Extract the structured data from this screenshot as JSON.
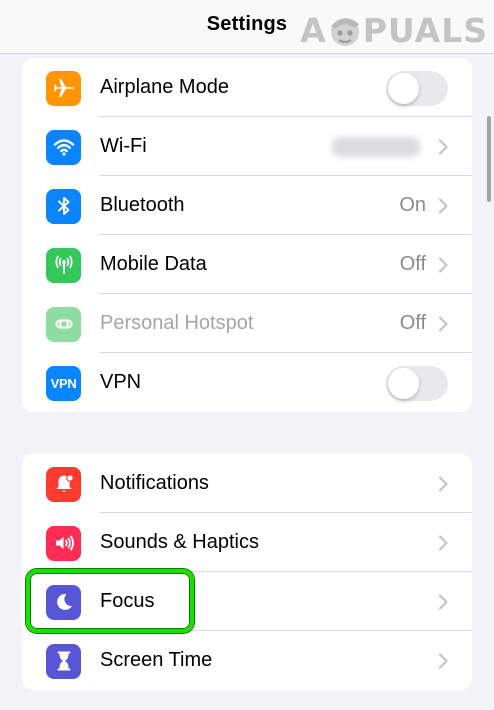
{
  "nav": {
    "title": "Settings"
  },
  "watermark": {
    "pre": "A",
    "post": "PUALS"
  },
  "colors": {
    "airplane": "#ff9500",
    "wifi": "#0a84ff",
    "bluetooth": "#0a84ff",
    "mobile_data": "#34c759",
    "hotspot": "#8fdca3",
    "vpn": "#0a84ff",
    "notifications": "#ff3b30",
    "sounds": "#ff2d55",
    "focus": "#5856d6",
    "screen_time": "#5856d6",
    "highlight": "#19e000"
  },
  "group1": [
    {
      "icon": "airplane-icon",
      "label": "Airplane Mode",
      "control": "toggle",
      "toggle_on": false
    },
    {
      "icon": "wifi-icon",
      "label": "Wi-Fi",
      "control": "chevron",
      "value_redacted": true
    },
    {
      "icon": "bluetooth-icon",
      "label": "Bluetooth",
      "value": "On",
      "control": "chevron"
    },
    {
      "icon": "antenna-icon",
      "label": "Mobile Data",
      "value": "Off",
      "control": "chevron"
    },
    {
      "icon": "hotspot-link-icon",
      "label": "Personal Hotspot",
      "value": "Off",
      "control": "chevron",
      "disabled": true
    },
    {
      "icon": "vpn-icon",
      "icon_text": "VPN",
      "label": "VPN",
      "control": "toggle",
      "toggle_on": false
    }
  ],
  "group2": [
    {
      "icon": "bell-icon",
      "label": "Notifications",
      "control": "chevron"
    },
    {
      "icon": "speaker-icon",
      "label": "Sounds & Haptics",
      "control": "chevron"
    },
    {
      "icon": "moon-icon",
      "label": "Focus",
      "control": "chevron",
      "highlighted": true
    },
    {
      "icon": "hourglass-icon",
      "label": "Screen Time",
      "control": "chevron"
    }
  ]
}
